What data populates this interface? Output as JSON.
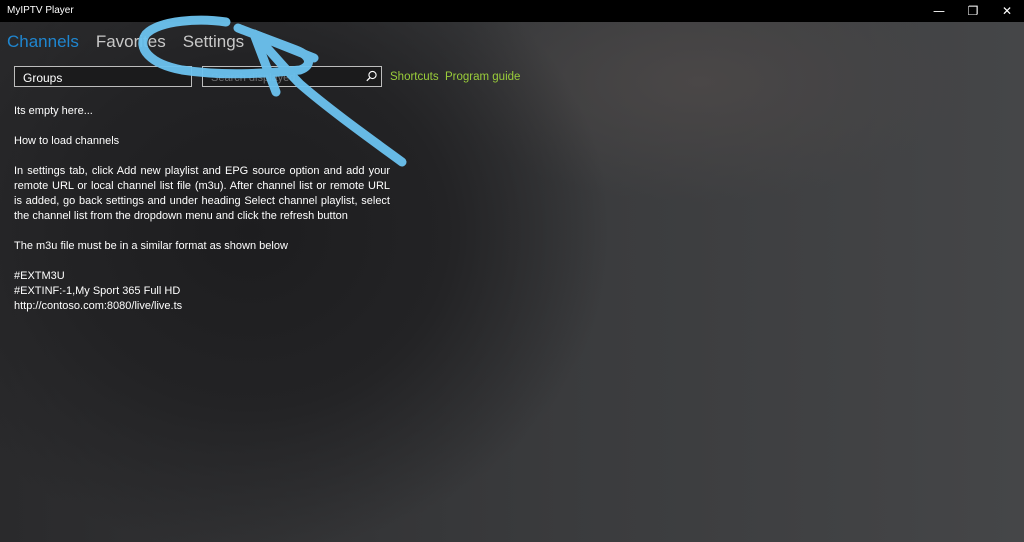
{
  "window": {
    "title": "MyIPTV Player",
    "minimize_glyph": "—",
    "maximize_glyph": "❐",
    "close_glyph": "✕"
  },
  "nav": {
    "tabs": [
      {
        "label": "Channels",
        "active": true
      },
      {
        "label": "Favorites",
        "active": false
      },
      {
        "label": "Settings",
        "active": false
      }
    ]
  },
  "toolbar": {
    "groups_label": "Groups",
    "search_placeholder": "Search displayed",
    "shortcuts_label": "Shortcuts",
    "program_guide_label": "Program guide"
  },
  "content": {
    "empty_title": "Its empty here...",
    "howto_heading": "How to load  channels",
    "instructions": "In settings tab, click Add new playlist and EPG source  option and add your remote URL or local channel list file (m3u). After channel list or remote URL is added, go back settings and under heading  Select channel playlist, select the channel list from the dropdown menu and click the refresh button",
    "format_note": "The m3u file must be in a similar format as shown below",
    "example_lines": [
      "#EXTM3U",
      "#EXTINF:-1,My Sport 365 Full HD",
      "http://contoso.com:8080/live/live.ts"
    ]
  },
  "colors": {
    "accent_active_tab": "#1f86d0",
    "link_green": "#9acd3a",
    "annotation_blue": "#6cc3f0"
  },
  "icons": {
    "search": "search-icon",
    "minimize": "minimize-icon",
    "maximize": "restore-icon",
    "close": "close-icon"
  }
}
